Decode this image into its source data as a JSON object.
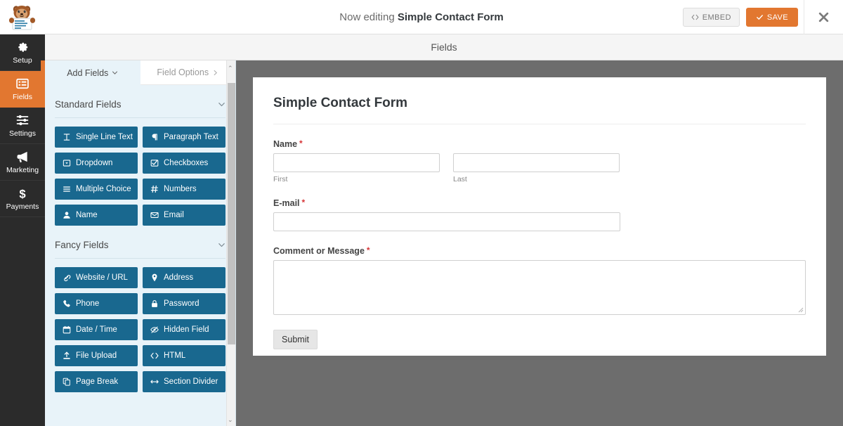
{
  "header": {
    "editing_prefix": "Now editing",
    "form_name": "Simple Contact Form",
    "embed_label": "EMBED",
    "embed_icon": "code-icon",
    "save_label": "SAVE",
    "save_icon": "check-icon",
    "close_icon": "close-icon",
    "logo_icon": "wpforms-sullie-mascot-icon",
    "accent_orange": "#e27730"
  },
  "subheader": {
    "title": "Fields"
  },
  "sidebar": {
    "items": [
      {
        "label": "Setup",
        "icon": "gear-icon",
        "active": false
      },
      {
        "label": "Fields",
        "icon": "list-icon",
        "active": true
      },
      {
        "label": "Settings",
        "icon": "sliders-icon",
        "active": false
      },
      {
        "label": "Marketing",
        "icon": "megaphone-icon",
        "active": false
      },
      {
        "label": "Payments",
        "icon": "dollar-icon",
        "active": false
      }
    ]
  },
  "panel": {
    "tabs": [
      {
        "label": "Add Fields",
        "icon": "chevron-down-icon",
        "active": true
      },
      {
        "label": "Field Options",
        "icon": "chevron-right-icon",
        "active": false
      }
    ],
    "groups": [
      {
        "title": "Standard Fields",
        "toggle_icon": "chevron-down-icon",
        "fields": [
          {
            "label": "Single Line Text",
            "icon": "text-cursor-icon"
          },
          {
            "label": "Paragraph Text",
            "icon": "paragraph-icon"
          },
          {
            "label": "Dropdown",
            "icon": "dropdown-icon"
          },
          {
            "label": "Checkboxes",
            "icon": "checkbox-icon"
          },
          {
            "label": "Multiple Choice",
            "icon": "list-ul-icon"
          },
          {
            "label": "Numbers",
            "icon": "hash-icon"
          },
          {
            "label": "Name",
            "icon": "user-icon"
          },
          {
            "label": "Email",
            "icon": "envelope-icon"
          }
        ]
      },
      {
        "title": "Fancy Fields",
        "toggle_icon": "chevron-down-icon",
        "fields": [
          {
            "label": "Website / URL",
            "icon": "link-icon"
          },
          {
            "label": "Address",
            "icon": "map-pin-icon"
          },
          {
            "label": "Phone",
            "icon": "phone-icon"
          },
          {
            "label": "Password",
            "icon": "lock-icon"
          },
          {
            "label": "Date / Time",
            "icon": "calendar-icon"
          },
          {
            "label": "Hidden Field",
            "icon": "eye-slash-icon"
          },
          {
            "label": "File Upload",
            "icon": "upload-icon"
          },
          {
            "label": "HTML",
            "icon": "code-icon"
          },
          {
            "label": "Page Break",
            "icon": "files-icon"
          },
          {
            "label": "Section Divider",
            "icon": "arrows-horizontal-icon"
          }
        ]
      }
    ],
    "scrollbar": {
      "visible": true
    }
  },
  "preview": {
    "form_title": "Simple Contact Form",
    "required_marker": "*",
    "fields": [
      {
        "label": "Name",
        "required": true,
        "type": "name",
        "value": "",
        "sublabels": [
          "First",
          "Last"
        ]
      },
      {
        "label": "E-mail",
        "required": true,
        "type": "email",
        "value": ""
      },
      {
        "label": "Comment or Message",
        "required": true,
        "type": "textarea",
        "value": ""
      }
    ],
    "submit_label": "Submit"
  }
}
